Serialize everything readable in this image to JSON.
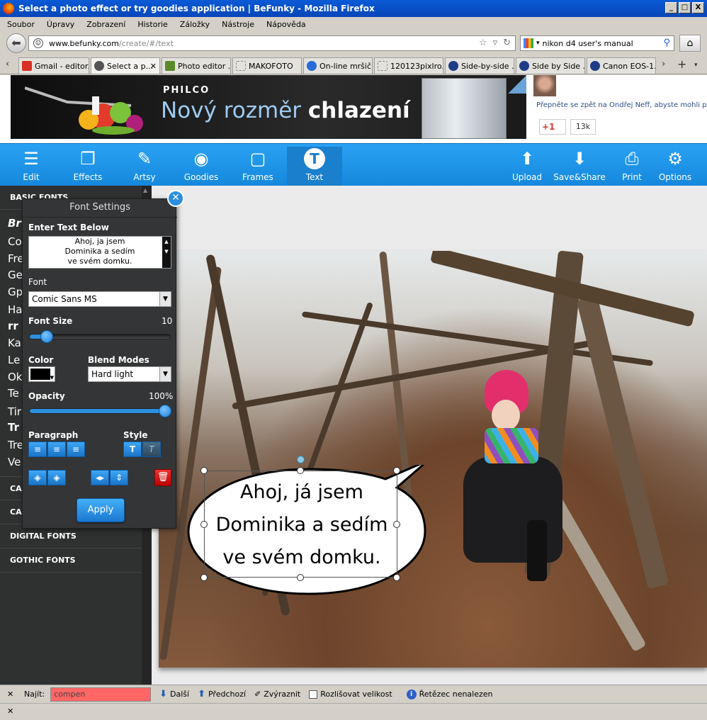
{
  "window": {
    "title": "Select a photo effect or try goodies application | BeFunky - Mozilla Firefox",
    "buttons": [
      "_",
      "□",
      "X"
    ]
  },
  "menu": [
    "Soubor",
    "Úpravy",
    "Zobrazení",
    "Historie",
    "Záložky",
    "Nástroje",
    "Nápověda"
  ],
  "nav": {
    "url_host": "www.befunky.com",
    "url_path": "/create/#/text",
    "search_value": "nikon d4 user's manual"
  },
  "tabs": [
    {
      "label": "Gmail - editor...",
      "icon_color": "#d93025",
      "active": false
    },
    {
      "label": "Select a p...",
      "icon_color": "#555555",
      "active": true
    },
    {
      "label": "Photo editor ...",
      "icon_color": "#5a8a2a",
      "active": false
    },
    {
      "label": "MAKOFOTO",
      "icon_color": "#888888",
      "active": false
    },
    {
      "label": "On-line mršič ...",
      "icon_color": "#2a6ad6",
      "active": false
    },
    {
      "label": "120123pixlro...",
      "icon_color": "#888888",
      "active": false
    },
    {
      "label": "Side-by-side ...",
      "icon_color": "#1f3c88",
      "active": false
    },
    {
      "label": "Side by Side ...",
      "icon_color": "#1f3c88",
      "active": false
    },
    {
      "label": "Canon EOS-1...",
      "icon_color": "#1f3c88",
      "active": false
    }
  ],
  "ad": {
    "brand": "PHILCO",
    "headline_light": "Nový rozměr",
    "headline_bold": "chlazení"
  },
  "social": {
    "text": "Přepněte se zpět na Ondřej Neff, abyste mohli po",
    "gplus_label": "+1",
    "gplus_count": "13k"
  },
  "toolbar": {
    "left": [
      {
        "label": "Edit",
        "icon": "sliders-icon"
      },
      {
        "label": "Effects",
        "icon": "effects-icon"
      },
      {
        "label": "Artsy",
        "icon": "palette-icon"
      },
      {
        "label": "Goodies",
        "icon": "goodies-icon"
      },
      {
        "label": "Frames",
        "icon": "frame-icon"
      },
      {
        "label": "Text",
        "icon": "text-icon",
        "active": true
      }
    ],
    "right": [
      {
        "label": "Upload",
        "icon": "upload-icon"
      },
      {
        "label": "Save&Share",
        "icon": "download-icon"
      },
      {
        "label": "Print",
        "icon": "print-icon"
      },
      {
        "label": "Options",
        "icon": "gear-icon"
      }
    ]
  },
  "left_panel": {
    "basic_fonts_label": "BASIC FONTS",
    "fonts": [
      "Br",
      "Co",
      "Fre",
      "Ge",
      "Gp",
      "Ha",
      "rr",
      "Ka",
      "Le",
      "Ok",
      "Te",
      "Tir",
      "Tr",
      "Tre",
      "Ve"
    ],
    "categories": [
      "CA",
      "CA",
      "DIGITAL FONTS",
      "GOTHIC FONTS"
    ]
  },
  "font_settings": {
    "title": "Font Settings",
    "enter_text_label": "Enter Text Below",
    "text_lines": [
      "Ahoj, ja jsem",
      "Dominika a sedím",
      "ve svém domku."
    ],
    "font_label": "Font",
    "font_value": "Comic Sans MS",
    "font_size_label": "Font Size",
    "font_size_value": "10",
    "font_size_fraction": 0.08,
    "color_label": "Color",
    "color_value": "#000000",
    "blend_label": "Blend Modes",
    "blend_value": "Hard light",
    "opacity_label": "Opacity",
    "opacity_value": "100%",
    "opacity_fraction": 1.0,
    "paragraph_label": "Paragraph",
    "style_label": "Style",
    "apply_label": "Apply"
  },
  "bubble": {
    "lines": [
      "Ahoj, já jsem",
      "Dominika a sedím",
      "ve svém domku."
    ]
  },
  "findbar": {
    "find_label": "Najít:",
    "find_value": "compen",
    "next_label": "Další",
    "prev_label": "Předchozí",
    "highlight_label": "Zvýraznit",
    "matchcase_label": "Rozlišovat velikost",
    "status": "Řetězec nenalezen"
  }
}
